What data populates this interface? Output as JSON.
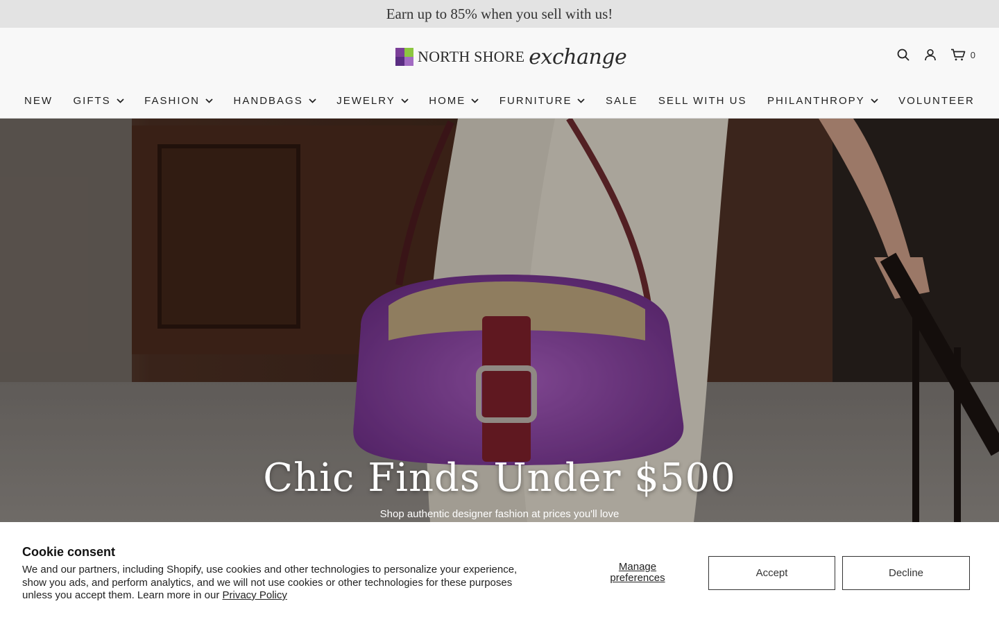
{
  "announcement": "Earn up to 85% when you sell with us!",
  "logo": {
    "text_main": "NORTH SHORE",
    "text_script": "exchange",
    "colors": [
      "#7b3f98",
      "#8cc63f",
      "#5a2d82",
      "#a26bc2"
    ]
  },
  "header_icons": {
    "search": "search-icon",
    "account": "user-icon",
    "cart": "cart-icon",
    "cart_count": "0"
  },
  "nav": [
    {
      "label": "NEW",
      "dropdown": false
    },
    {
      "label": "GIFTS",
      "dropdown": true
    },
    {
      "label": "FASHION",
      "dropdown": true
    },
    {
      "label": "HANDBAGS",
      "dropdown": true
    },
    {
      "label": "JEWELRY",
      "dropdown": true
    },
    {
      "label": "HOME",
      "dropdown": true
    },
    {
      "label": "FURNITURE",
      "dropdown": true
    },
    {
      "label": "SALE",
      "dropdown": false
    },
    {
      "label": "SELL WITH US",
      "dropdown": false
    },
    {
      "label": "PHILANTHROPY",
      "dropdown": true
    },
    {
      "label": "VOLUNTEER",
      "dropdown": false
    }
  ],
  "hero": {
    "title": "Chic Finds Under $500",
    "subtitle": "Shop authentic designer fashion at prices you'll love"
  },
  "cookie": {
    "title": "Cookie consent",
    "text": "We and our partners, including Shopify, use cookies and other technologies to personalize your experience, show you ads, and perform analytics, and we will not use cookies or other technologies for these purposes unless you accept them. Learn more in our ",
    "link": "Privacy Policy",
    "manage_line1": "Manage",
    "manage_line2": "preferences",
    "accept": "Accept",
    "decline": "Decline"
  }
}
